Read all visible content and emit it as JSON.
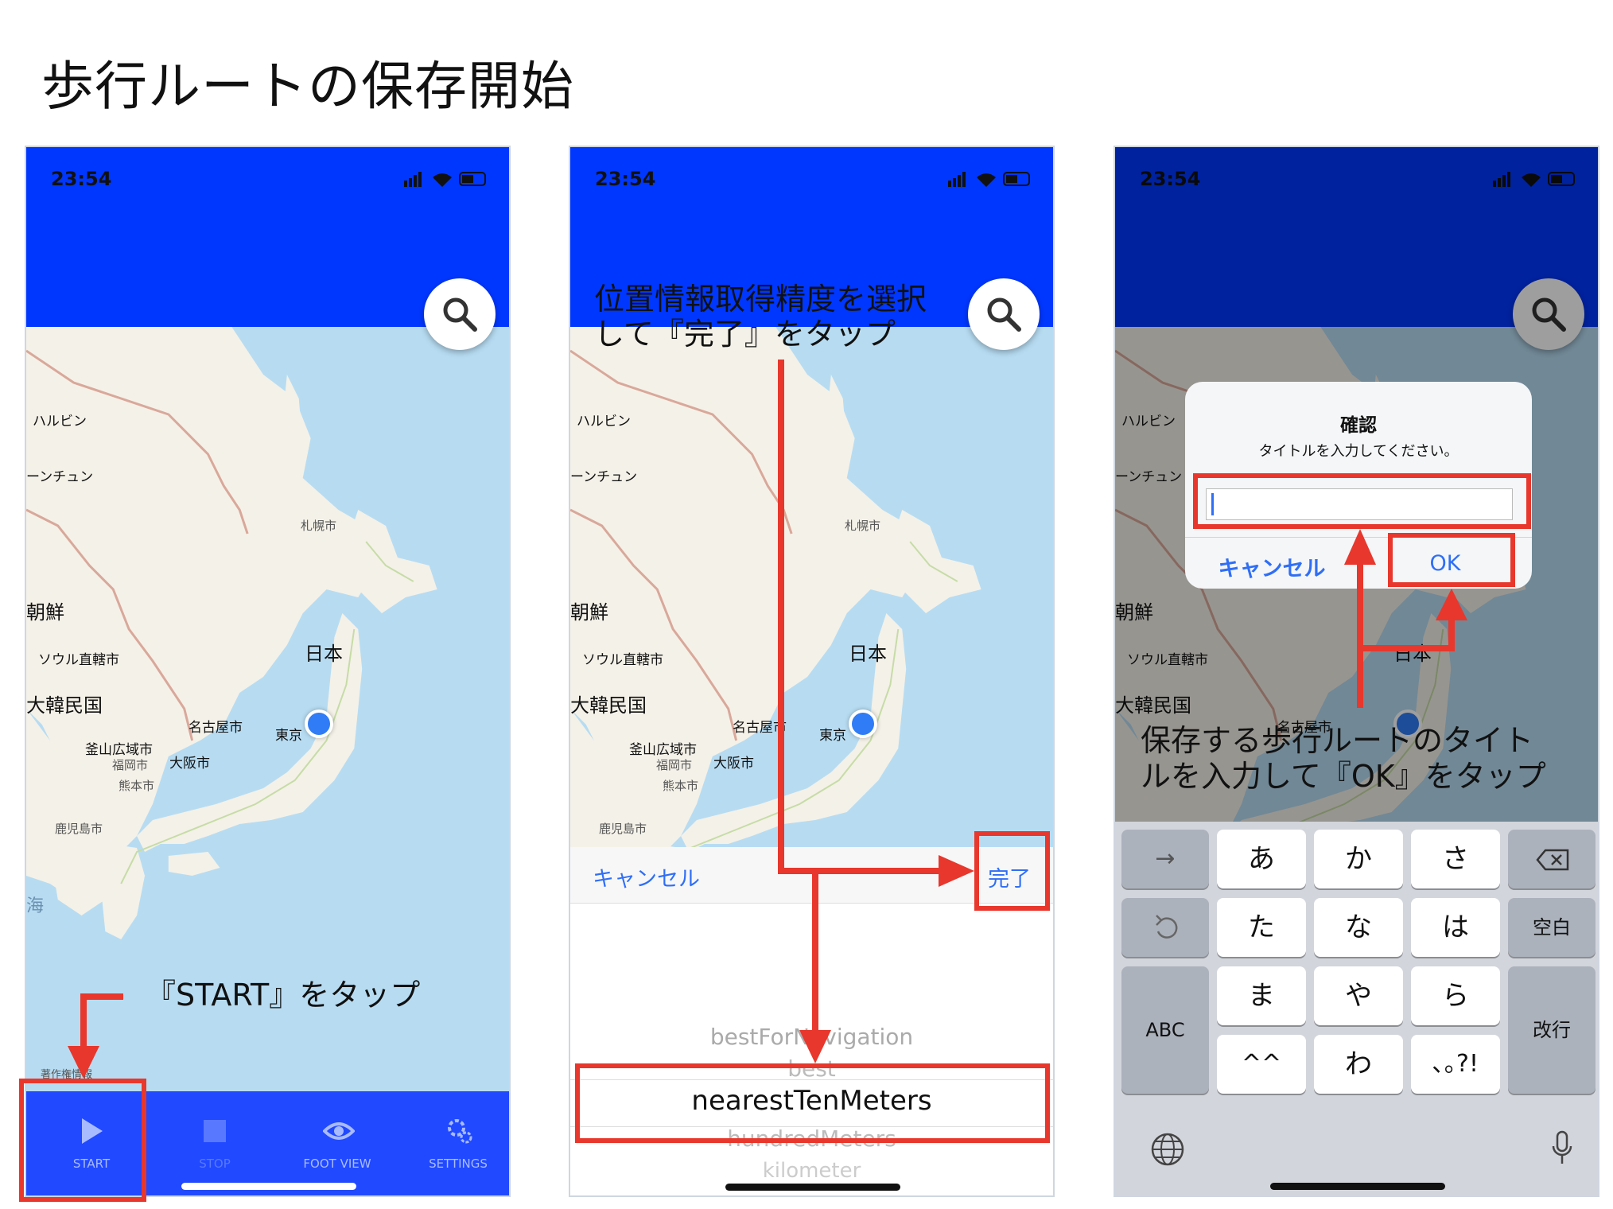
{
  "page": {
    "title": "歩行ルートの保存開始"
  },
  "status": {
    "time": "23:54"
  },
  "map": {
    "labels": {
      "harbin": "ハルビン",
      "changchun": "ーンチュン",
      "korea_north": "朝鮮",
      "seoul": "ソウル直轄市",
      "korea_south": "大韓民国",
      "japan": "日本",
      "sapporo": "札幌市",
      "nagoya": "名古屋市",
      "tokyo": "東京",
      "busan": "釜山広域市",
      "osaka": "大阪市",
      "fukuoka": "福岡市",
      "kumamoto": "熊本市",
      "kagoshima": "鹿児島市",
      "sea": "海",
      "attribution": "著作権情報"
    }
  },
  "tabs": {
    "start": "START",
    "stop": "STOP",
    "foot_view": "FOOT VIEW",
    "settings": "SETTINGS"
  },
  "annotations": {
    "start_note": "『START』をタップ",
    "accuracy_note_line1": "位置情報取得精度を選択",
    "accuracy_note_line2": "して『完了』をタップ",
    "title_note_line1": "保存する歩行ルートのタイト",
    "title_note_line2": "ルを入力して『OK』をタップ"
  },
  "picker": {
    "cancel": "キャンセル",
    "done": "完了",
    "options": [
      "bestForNavigation",
      "best",
      "nearestTenMeters",
      "hundredMeters",
      "kilometer"
    ],
    "selected": "nearestTenMeters"
  },
  "dialog": {
    "title": "確認",
    "message": "タイトルを入力してください。",
    "input_value": "",
    "cancel": "キャンセル",
    "ok": "OK"
  },
  "keyboard": {
    "row1": [
      "あ",
      "か",
      "さ"
    ],
    "row2": [
      "た",
      "な",
      "は"
    ],
    "row3": [
      "ま",
      "や",
      "ら"
    ],
    "row4": [
      "^^",
      "わ",
      "､｡?!"
    ],
    "space": "空白",
    "abc": "ABC",
    "return": "改行",
    "next_icon": "→"
  },
  "colors": {
    "header_blue": "#0037ff",
    "tab_blue": "#2149ff",
    "annotation_red": "#e8372c",
    "ios_blue": "#2f6ef6",
    "location_dot": "#2f7cf6"
  }
}
